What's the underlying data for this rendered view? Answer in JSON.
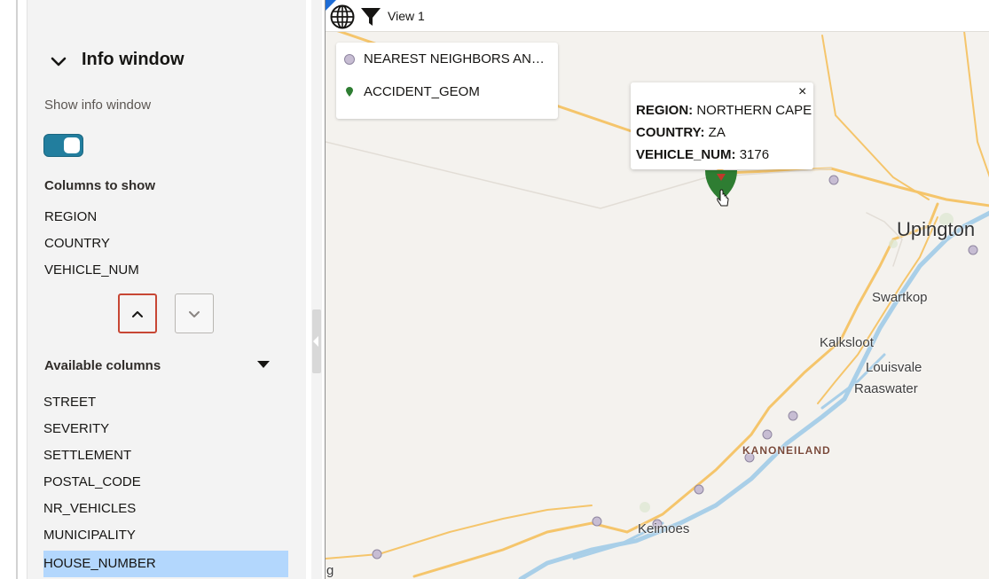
{
  "info_section": {
    "title": "Info window",
    "show_info_label": "Show info window",
    "show_info_enabled": true,
    "columns_to_show_label": "Columns to show",
    "columns_to_show": [
      "REGION",
      "COUNTRY",
      "VEHICLE_NUM"
    ],
    "available_columns_label": "Available columns",
    "available_columns": [
      "STREET",
      "SEVERITY",
      "SETTLEMENT",
      "POSTAL_CODE",
      "NR_VEHICLES",
      "MUNICIPALITY",
      "HOUSE_NUMBER"
    ],
    "selected_available": "HOUSE_NUMBER"
  },
  "map": {
    "view_label": "View 1",
    "legend": {
      "items": [
        {
          "label": "NEAREST NEIGHBORS AN…",
          "icon": "circle-marker-icon",
          "color": "#c7bdd3"
        },
        {
          "label": "ACCIDENT_GEOM",
          "icon": "pin-marker-icon",
          "color": "#2e7d32"
        }
      ]
    },
    "info_popup": {
      "fields": [
        {
          "key": "REGION:",
          "value": "NORTHERN CAPE"
        },
        {
          "key": "COUNTRY:",
          "value": "ZA"
        },
        {
          "key": "VEHICLE_NUM:",
          "value": "3176"
        }
      ],
      "close": "×"
    },
    "places": {
      "upington": "Upington",
      "swartkop": "Swartkop",
      "kalksloot": "Kalksloot",
      "louisvale": "Louisvale",
      "raaswater": "Raaswater",
      "kanoneiland": "KANONEILAND",
      "keimoes": "Keimoes",
      "edge_g": "g"
    },
    "colors": {
      "road": "#f5c56b",
      "river": "#a9cfe8",
      "marker": "#c7bdd3",
      "accident": "#2e7d32",
      "toggle": "#227e9e",
      "selected_row": "#b3d7fd"
    }
  }
}
